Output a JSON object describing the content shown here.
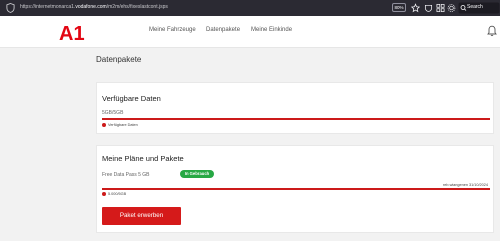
{
  "browser": {
    "url_prefix": "https://internetmonarca1.",
    "url_domain": "vodafone.com",
    "url_path": "/m2m/ehs/fixeslastcont.jsps",
    "zoom": "80%",
    "search_label": "Search"
  },
  "header": {
    "logo_label": "A1",
    "nav": [
      "Meine Fahrzeuge",
      "Datenpakete",
      "Meine Einkinde"
    ]
  },
  "page": {
    "title": "Datenpakete"
  },
  "available_data": {
    "title": "Verfügbare Daten",
    "amount": "5GB/5GB",
    "legend": "Verfügbare Daten",
    "fill_fraction": 1.0
  },
  "plans": {
    "title": "Meine Pläne und Pakete",
    "plan_name": "Free Data Pass 5 GB",
    "status_badge": "In Gebrauch",
    "validity": "reb.wiangenen 31/10/2024",
    "usage": "5.000/5GB",
    "fill_fraction": 1.0,
    "button_label": "Paket erwerben"
  },
  "colors": {
    "brand_red": "#cc1a1a",
    "badge_green": "#27a844",
    "chrome_dark": "#2b2a33"
  }
}
